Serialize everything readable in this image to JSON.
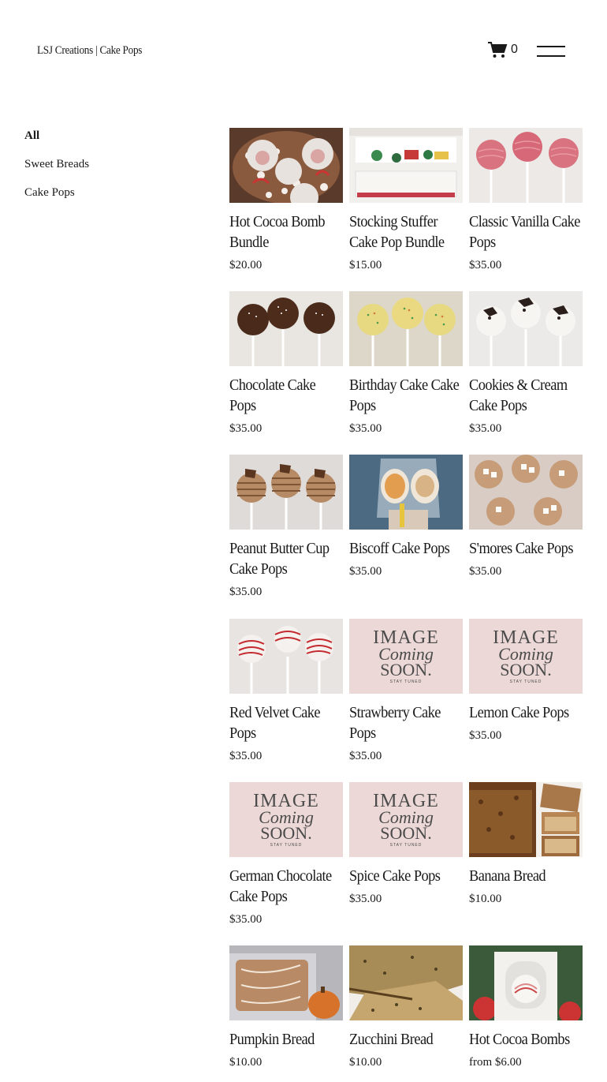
{
  "header": {
    "site_title": "LSJ Creations | Cake Pops",
    "cart_count": "0"
  },
  "sidebar": {
    "categories": [
      {
        "label": "All",
        "active": true
      },
      {
        "label": "Sweet Breads",
        "active": false
      },
      {
        "label": "Cake Pops",
        "active": false
      }
    ]
  },
  "products": [
    {
      "title": "Hot Cocoa Bomb Bundle",
      "price": "$20.00",
      "image": "cocoa-bundle"
    },
    {
      "title": "Stocking Stuffer Cake Pop Bundle",
      "price": "$15.00",
      "image": "stocking-box"
    },
    {
      "title": "Classic Vanilla Cake Pops",
      "price": "$35.00",
      "image": "pink-pops"
    },
    {
      "title": "Chocolate Cake Pops",
      "price": "$35.00",
      "image": "chocolate-pops"
    },
    {
      "title": "Birthday Cake Cake Pops",
      "price": "$35.00",
      "image": "yellow-sprinkle-pops"
    },
    {
      "title": "Cookies & Cream Cake Pops",
      "price": "$35.00",
      "image": "oreo-pops"
    },
    {
      "title": "Peanut Butter Cup Cake Pops",
      "price": "$35.00",
      "image": "pb-pops"
    },
    {
      "title": "Biscoff Cake Pops",
      "price": "$35.00",
      "image": "biscoff-pop"
    },
    {
      "title": "S'mores Cake Pops",
      "price": "$35.00",
      "image": "smores"
    },
    {
      "title": "Red Velvet Cake Pops",
      "price": "$35.00",
      "image": "red-stripe-pops"
    },
    {
      "title": "Strawberry Cake Pops",
      "price": "$35.00",
      "image": "coming-soon"
    },
    {
      "title": "Lemon Cake Pops",
      "price": "$35.00",
      "image": "coming-soon"
    },
    {
      "title": "German Chocolate Cake Pops",
      "price": "$35.00",
      "image": "coming-soon"
    },
    {
      "title": "Spice Cake Pops",
      "price": "$35.00",
      "image": "coming-soon"
    },
    {
      "title": "Banana Bread",
      "price": "$10.00",
      "image": "banana-bread"
    },
    {
      "title": "Pumpkin Bread",
      "price": "$10.00",
      "image": "pumpkin-bread"
    },
    {
      "title": "Zucchini Bread",
      "price": "$10.00",
      "image": "zucchini-bread"
    },
    {
      "title": "Hot Cocoa Bombs",
      "price": "from $6.00",
      "image": "cocoa-bomb-box"
    }
  ],
  "placeholder_image": {
    "line1": "IMAGE",
    "line2": "Coming",
    "line3": "SOON.",
    "line4": "STAY TUNED"
  }
}
